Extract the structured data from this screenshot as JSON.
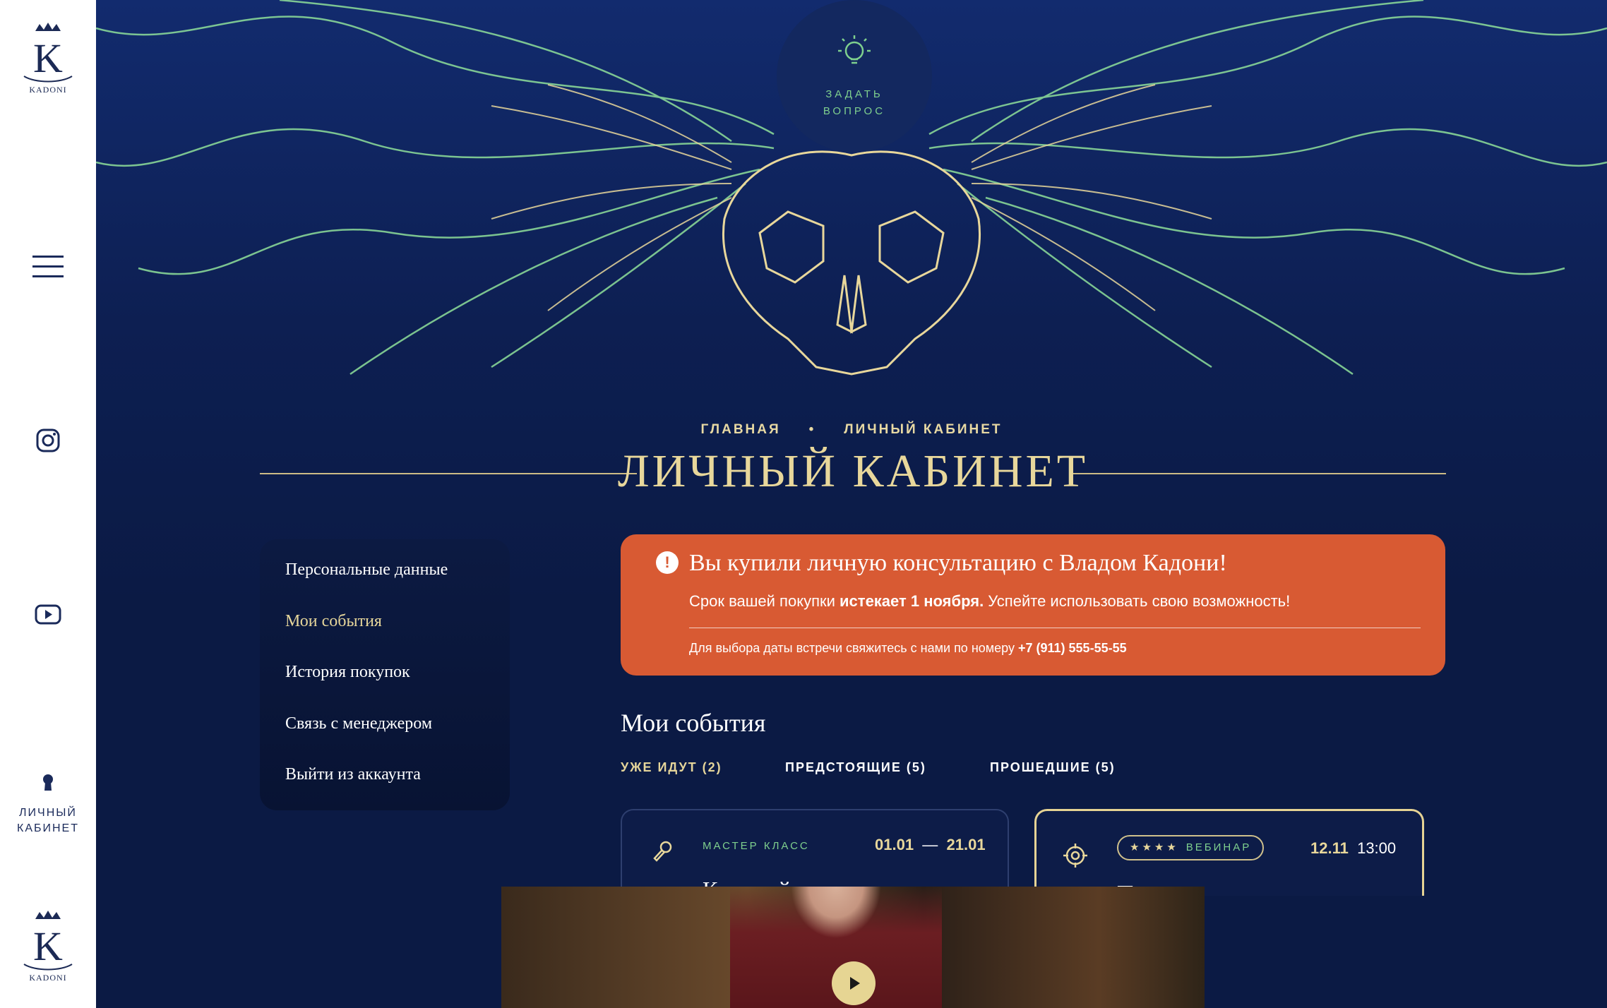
{
  "sidebar": {
    "logo_text": "KADONI",
    "cabinet_label_1": "ЛИЧНЫЙ",
    "cabinet_label_2": "КАБИНЕТ"
  },
  "hero": {
    "ask_line1": "ЗАДАТЬ",
    "ask_line2": "ВОПРОС"
  },
  "breadcrumb": {
    "home": "ГЛАВНАЯ",
    "separator": "•",
    "current": "ЛИЧНЫЙ КАБИНЕТ"
  },
  "page_title": "ЛИЧНЫЙ КАБИНЕТ",
  "menu": {
    "items": [
      {
        "label": "Персональные данные"
      },
      {
        "label": "Мои события"
      },
      {
        "label": "История покупок"
      },
      {
        "label": "Связь с менеджером"
      },
      {
        "label": "Выйти из аккаунта"
      }
    ]
  },
  "alert": {
    "icon": "!",
    "title": "Вы купили личную консультацию с Владом Кадони!",
    "sub_before": "Срок вашей покупки ",
    "sub_bold": "истекает 1 ноября.",
    "sub_after": " Успейте использовать свою возможность!",
    "contact_text": "Для выбора даты встречи свяжитесь с нами по номеру ",
    "contact_phone": "+7 (911) 555-55-55"
  },
  "events": {
    "title": "Мои события",
    "tabs": [
      {
        "label": "УЖЕ ИДУТ (2)"
      },
      {
        "label": "ПРЕДСТОЯЩИЕ (5)"
      },
      {
        "label": "ПРОШЕДШИЕ (5)"
      }
    ],
    "cards": [
      {
        "type": "МАСТЕР КЛАСС",
        "date_from": "01.01",
        "date_sep": "—",
        "date_to": "21.01",
        "heading": "Как пройти кастинг на"
      },
      {
        "stars": "★★★★",
        "type": "ВЕБИНАР",
        "date": "12.11",
        "time": "13:00",
        "heading": "П"
      }
    ]
  },
  "colors": {
    "background": "#0c1b45",
    "accent_gold": "#e8d79b",
    "accent_green": "#7fd08e",
    "alert": "#d85a33"
  }
}
